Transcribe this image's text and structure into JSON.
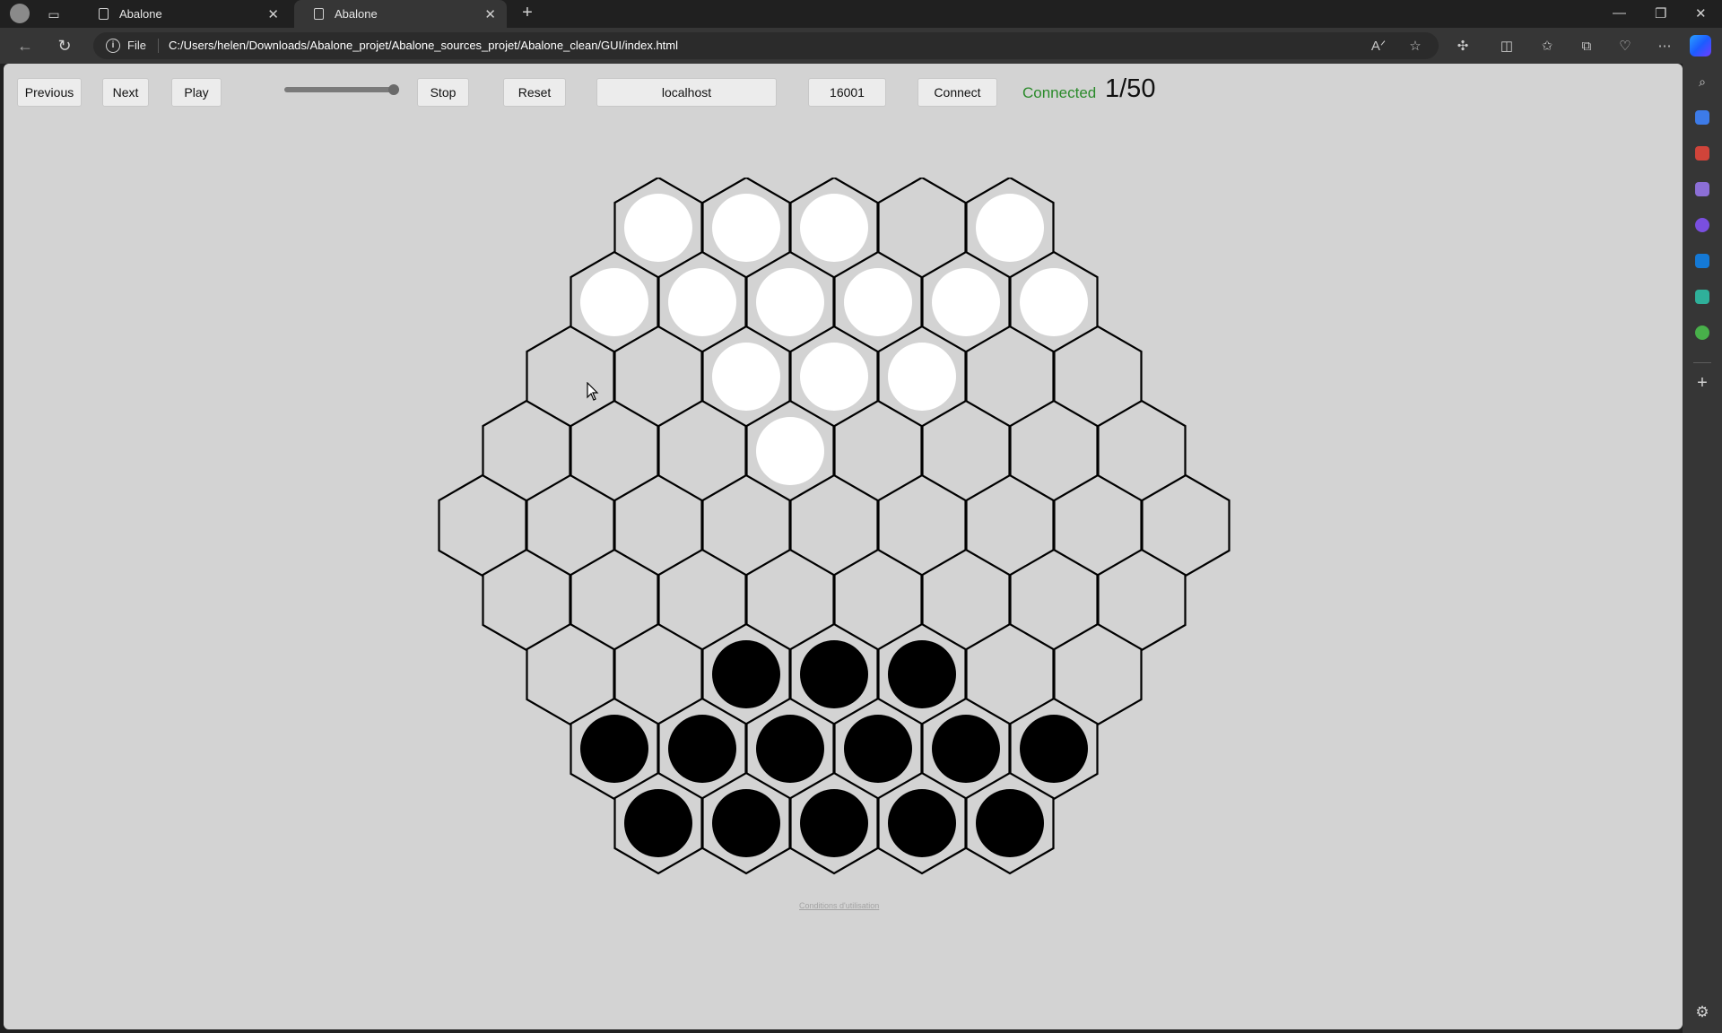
{
  "browser": {
    "tabs": [
      {
        "title": "Abalone",
        "active": false
      },
      {
        "title": "Abalone",
        "active": true
      }
    ],
    "address": {
      "scheme_label": "File",
      "url": "C:/Users/helen/Downloads/Abalone_projet/Abalone_sources_projet/Abalone_clean/GUI/index.html"
    }
  },
  "toolbar": {
    "previous_label": "Previous",
    "next_label": "Next",
    "play_label": "Play",
    "speed_slider_value": 1.0,
    "stop_label": "Stop",
    "reset_label": "Reset",
    "host_value": "localhost",
    "port_value": "16001",
    "connect_label": "Connect",
    "status_text": "Connected",
    "status_color": "#2a8a2a",
    "move_counter": "1/50"
  },
  "board": {
    "rows": [
      "WWW.W",
      "WWWWWW",
      "..WWW..",
      "...W....",
      ".........",
      "........",
      "..BBB..",
      "BBBBBB",
      "BBBBB"
    ],
    "white_color": "#ffffff",
    "black_color": "#000000",
    "cell_color": "#d3d3d3",
    "line_color": "#000000"
  },
  "footer": {
    "text": "Conditions d'utilisation"
  }
}
